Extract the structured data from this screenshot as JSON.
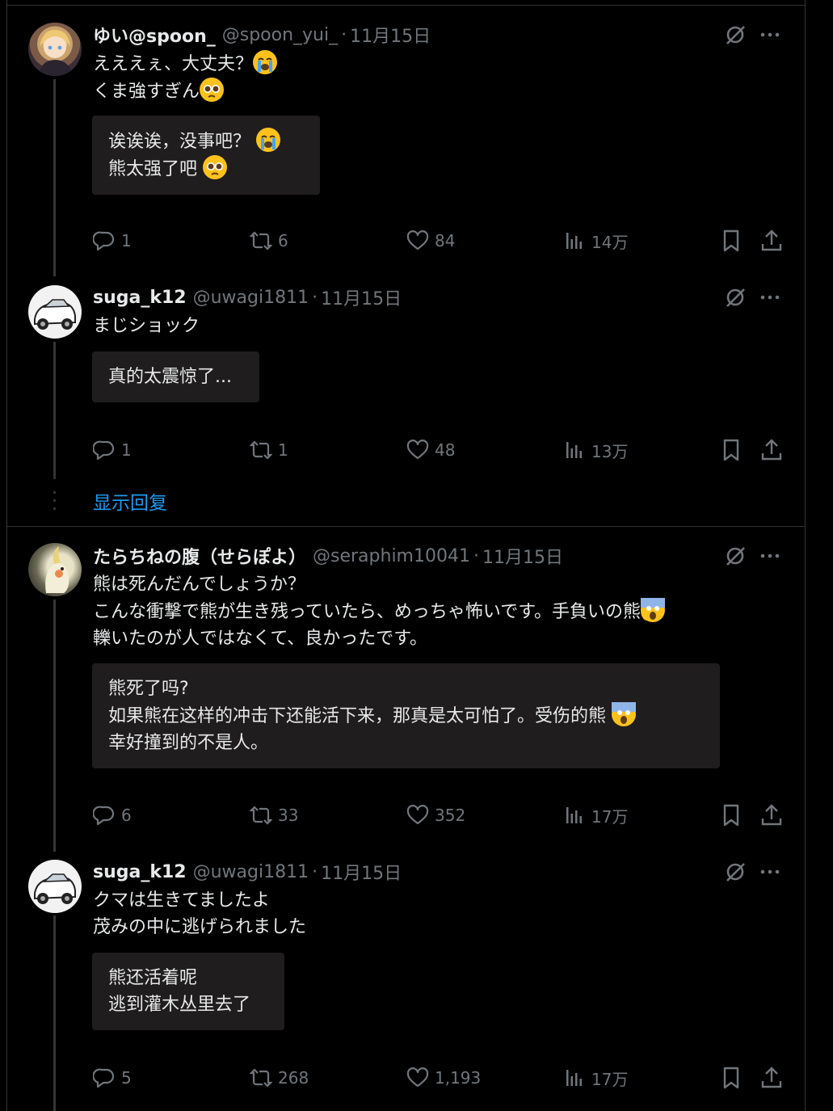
{
  "tweets": [
    {
      "name": "ゆい@spoon_",
      "handle": "@spoon_yui_",
      "sep": "·",
      "date": "11月15日",
      "lines": [
        "えええぇ、大丈夫？",
        "くま強すぎん"
      ],
      "translation": [
        "诶诶诶，没事吧？",
        "熊太强了吧"
      ],
      "stats": {
        "replies": "1",
        "reposts": "6",
        "likes": "84",
        "views": "14万"
      }
    },
    {
      "name": "suga_k12",
      "handle": "@uwagi1811",
      "sep": "·",
      "date": "11月15日",
      "lines": [
        "まじショック"
      ],
      "translation": [
        "真的太震惊了..."
      ],
      "stats": {
        "replies": "1",
        "reposts": "1",
        "likes": "48",
        "views": "13万"
      }
    },
    {
      "name": "たらちねの腹（せらぽよ）",
      "handle": "@seraphim10041",
      "sep": "·",
      "date": "11月15日",
      "lines": [
        "熊は死んだんでしょうか？",
        "こんな衝撃で熊が生き残っていたら、めっちゃ怖いです。手負いの熊",
        "轢いたのが人ではなくて、良かったです。"
      ],
      "translation": [
        "熊死了吗?",
        "如果熊在这样的冲击下还能活下来，那真是太可怕了。受伤的熊",
        "幸好撞到的不是人。"
      ],
      "stats": {
        "replies": "6",
        "reposts": "33",
        "likes": "352",
        "views": "17万"
      }
    },
    {
      "name": "suga_k12",
      "handle": "@uwagi1811",
      "sep": "·",
      "date": "11月15日",
      "lines": [
        "クマは生きてましたよ",
        "茂みの中に逃げられました"
      ],
      "translation": [
        "熊还活着呢",
        "逃到灌木丛里去了"
      ],
      "stats": {
        "replies": "5",
        "reposts": "268",
        "likes": "1,193",
        "views": "17万"
      }
    }
  ],
  "show_replies": "显示回复",
  "icons": [
    "grok-icon",
    "more-icon",
    "reply-icon",
    "repost-icon",
    "like-icon",
    "views-icon",
    "bookmark-icon",
    "share-icon",
    "crying-emoji",
    "pleading-emoji",
    "scream-emoji"
  ],
  "colors": {
    "background": "#000000",
    "text": "#e7e9ea",
    "muted": "#71767b",
    "link": "#1d9bf0",
    "translation_box": "#201d1e"
  }
}
